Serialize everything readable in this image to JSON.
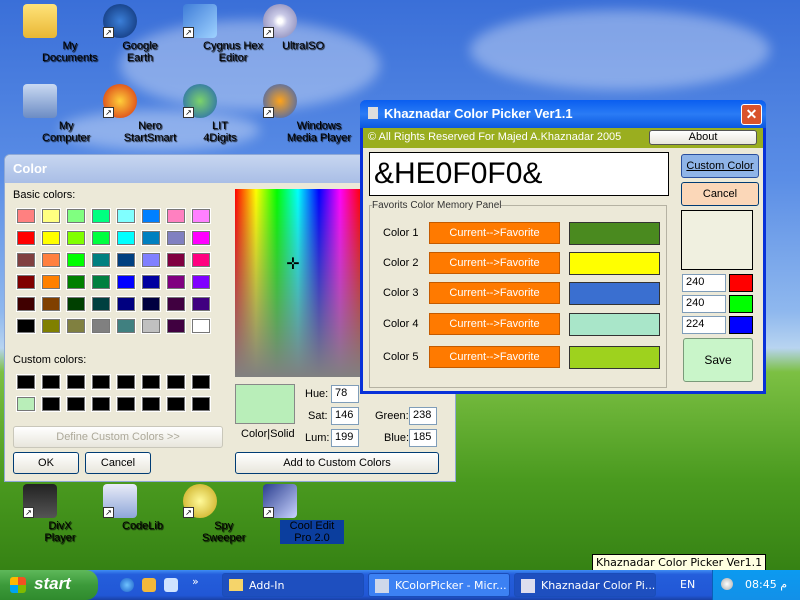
{
  "desktop": {
    "icons": [
      {
        "label": "My Documents"
      },
      {
        "label": "Google Earth"
      },
      {
        "label": "Cygnus Hex Editor"
      },
      {
        "label": "UltraISO"
      },
      {
        "label": "My Computer"
      },
      {
        "label": "Nero StartSmart"
      },
      {
        "label": "LIT 4Digits"
      },
      {
        "label": "Windows Media Player"
      },
      {
        "label": "DivX Player"
      },
      {
        "label": "CodeLib"
      },
      {
        "label": "Spy Sweeper"
      },
      {
        "label": "Cool Edit Pro 2.0"
      }
    ]
  },
  "color_dialog": {
    "title": "Color",
    "basic_colors_label": "Basic colors:",
    "custom_colors_label": "Custom colors:",
    "define_custom_label": "Define Custom Colors >>",
    "ok_label": "OK",
    "cancel_label": "Cancel",
    "add_custom_label": "Add to Custom Colors",
    "color_solid_label": "Color|Solid",
    "hue_label": "Hue:",
    "hue_value": "78",
    "sat_label": "Sat:",
    "sat_value": "146",
    "lum_label": "Lum:",
    "lum_value": "199",
    "green_label": "Green:",
    "green_value": "238",
    "blue_label": "Blue:",
    "blue_value": "185",
    "preview_color": "#b9eeb9",
    "basic_colors": [
      "#ff8080",
      "#ffff80",
      "#80ff80",
      "#00ff80",
      "#80ffff",
      "#0080ff",
      "#ff80c0",
      "#ff80ff",
      "#ff0000",
      "#ffff00",
      "#80ff00",
      "#00ff40",
      "#00ffff",
      "#0080c0",
      "#8080c0",
      "#ff00ff",
      "#804040",
      "#ff8040",
      "#00ff00",
      "#008080",
      "#004080",
      "#8080ff",
      "#800040",
      "#ff0080",
      "#800000",
      "#ff8000",
      "#008000",
      "#008040",
      "#0000ff",
      "#0000a0",
      "#800080",
      "#8000ff",
      "#400000",
      "#804000",
      "#004000",
      "#004040",
      "#000080",
      "#000040",
      "#400040",
      "#400080",
      "#000000",
      "#808000",
      "#808040",
      "#808080",
      "#408080",
      "#c0c0c0",
      "#400040",
      "#ffffff"
    ],
    "custom_colors": [
      "#000000",
      "#000000",
      "#000000",
      "#000000",
      "#000000",
      "#000000",
      "#000000",
      "#000000",
      "#b9eeb9",
      "#000000",
      "#000000",
      "#000000",
      "#000000",
      "#000000",
      "#000000",
      "#000000"
    ]
  },
  "khaznadar": {
    "title": "Khaznadar Color Picker Ver1.1",
    "copyright": "© All Rights Reserved For Majed A.Khaznadar 2005",
    "about_label": "About",
    "hex_value": "&HE0F0F0&",
    "custom_color_label": "Custom Color",
    "cancel_label": "Cancel",
    "panel_label": "Favorits Color Memory Panel",
    "favorite_button_label": "Current-->Favorite",
    "favorites": [
      {
        "label": "Color 1",
        "color": "#4a8a1f"
      },
      {
        "label": "Color 2",
        "color": "#ffff00"
      },
      {
        "label": "Color 3",
        "color": "#3a6fd0"
      },
      {
        "label": "Color 4",
        "color": "#a9e6c9"
      },
      {
        "label": "Color 5",
        "color": "#9ed21e"
      }
    ],
    "current_color": "#f0f0e0",
    "r_value": "240",
    "g_value": "240",
    "b_value": "224",
    "save_label": "Save"
  },
  "tooltip": "Khaznadar Color Picker Ver1.1",
  "taskbar": {
    "start_label": "start",
    "tasks": [
      {
        "label": "Add-In"
      },
      {
        "label": "KColorPicker - Micr..."
      },
      {
        "label": "Khaznadar Color Pi..."
      }
    ],
    "lang": "EN",
    "clock": "08:45 م"
  }
}
